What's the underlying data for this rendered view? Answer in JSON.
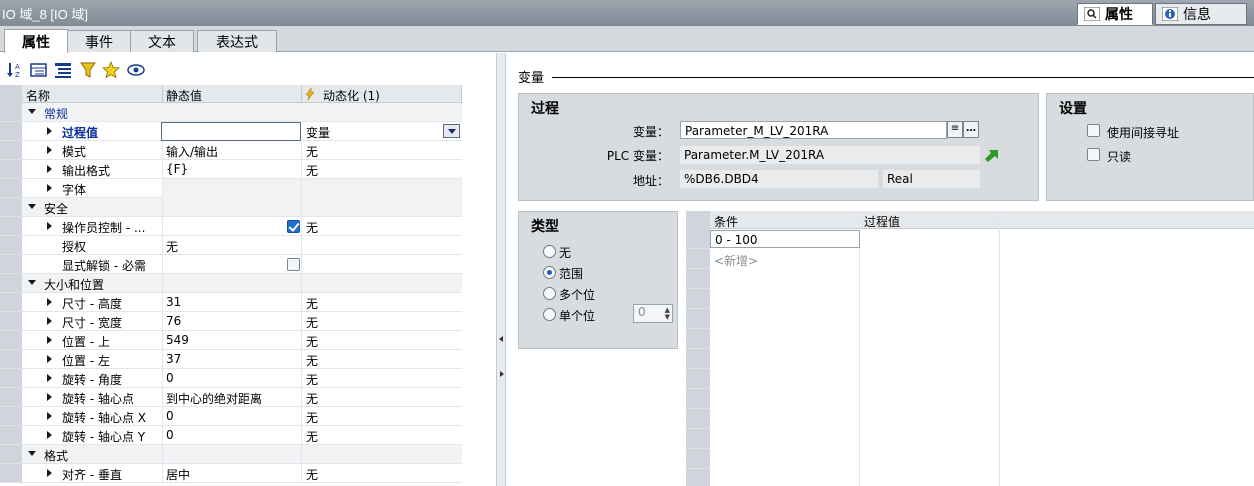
{
  "window": {
    "title": "IO 域_8 [IO 域]",
    "right_tabs": [
      {
        "label": "属性",
        "icon": "magnifier-icon",
        "active": true
      },
      {
        "label": "信息",
        "icon": "info-icon",
        "active": false
      }
    ]
  },
  "tabs": [
    "属性",
    "事件",
    "文本",
    "表达式"
  ],
  "grid": {
    "headers": {
      "name": "名称",
      "static": "静态值",
      "dynamic": "动态化 (1)"
    },
    "rows": [
      {
        "name": "常规",
        "value": "",
        "dyn": ""
      },
      {
        "name": "过程值",
        "value": "",
        "dyn": "变量"
      },
      {
        "name": "模式",
        "value": "输入/输出",
        "dyn": "无"
      },
      {
        "name": "输出格式",
        "value": "{F}",
        "dyn": "无"
      },
      {
        "name": "字体",
        "value": "",
        "dyn": ""
      },
      {
        "name": "安全",
        "value": "",
        "dyn": ""
      },
      {
        "name": "操作员控制 - ...",
        "value": "",
        "dyn": "无"
      },
      {
        "name": "授权",
        "value": "无",
        "dyn": ""
      },
      {
        "name": "显式解锁 - 必需",
        "value": "",
        "dyn": ""
      },
      {
        "name": "大小和位置",
        "value": "",
        "dyn": ""
      },
      {
        "name": "尺寸 - 高度",
        "value": "31",
        "dyn": "无"
      },
      {
        "name": "尺寸 - 宽度",
        "value": "76",
        "dyn": "无"
      },
      {
        "name": "位置 - 上",
        "value": "549",
        "dyn": "无"
      },
      {
        "name": "位置 - 左",
        "value": "37",
        "dyn": "无"
      },
      {
        "name": "旋转 - 角度",
        "value": "0",
        "dyn": "无"
      },
      {
        "name": "旋转 - 轴心点",
        "value": "到中心的绝对距离",
        "dyn": "无"
      },
      {
        "name": "旋转 - 轴心点 X",
        "value": "0",
        "dyn": "无"
      },
      {
        "name": "旋转 - 轴心点 Y",
        "value": "0",
        "dyn": "无"
      },
      {
        "name": "格式",
        "value": "",
        "dyn": ""
      },
      {
        "name": "对齐 - 垂直",
        "value": "居中",
        "dyn": "无"
      }
    ]
  },
  "right": {
    "section_title": "变量",
    "process": {
      "title": "过程",
      "variable_label": "变量：",
      "variable_value": "Parameter_M_LV_201RA",
      "plc_label": "PLC 变量：",
      "plc_value": "Parameter.M_LV_201RA",
      "address_label": "地址：",
      "address_value": "%DB6.DBD4",
      "address_type": "Real"
    },
    "settings": {
      "title": "设置",
      "indirect": "使用间接寻址",
      "readonly": "只读"
    },
    "type": {
      "title": "类型",
      "options": [
        "无",
        "范围",
        "多个位",
        "单个位"
      ],
      "selected": "范围",
      "spin_value": "0"
    },
    "conditions": {
      "col_condition": "条件",
      "col_value": "过程值",
      "rows": [
        "0 - 100"
      ],
      "add_label": "<新增>"
    }
  }
}
